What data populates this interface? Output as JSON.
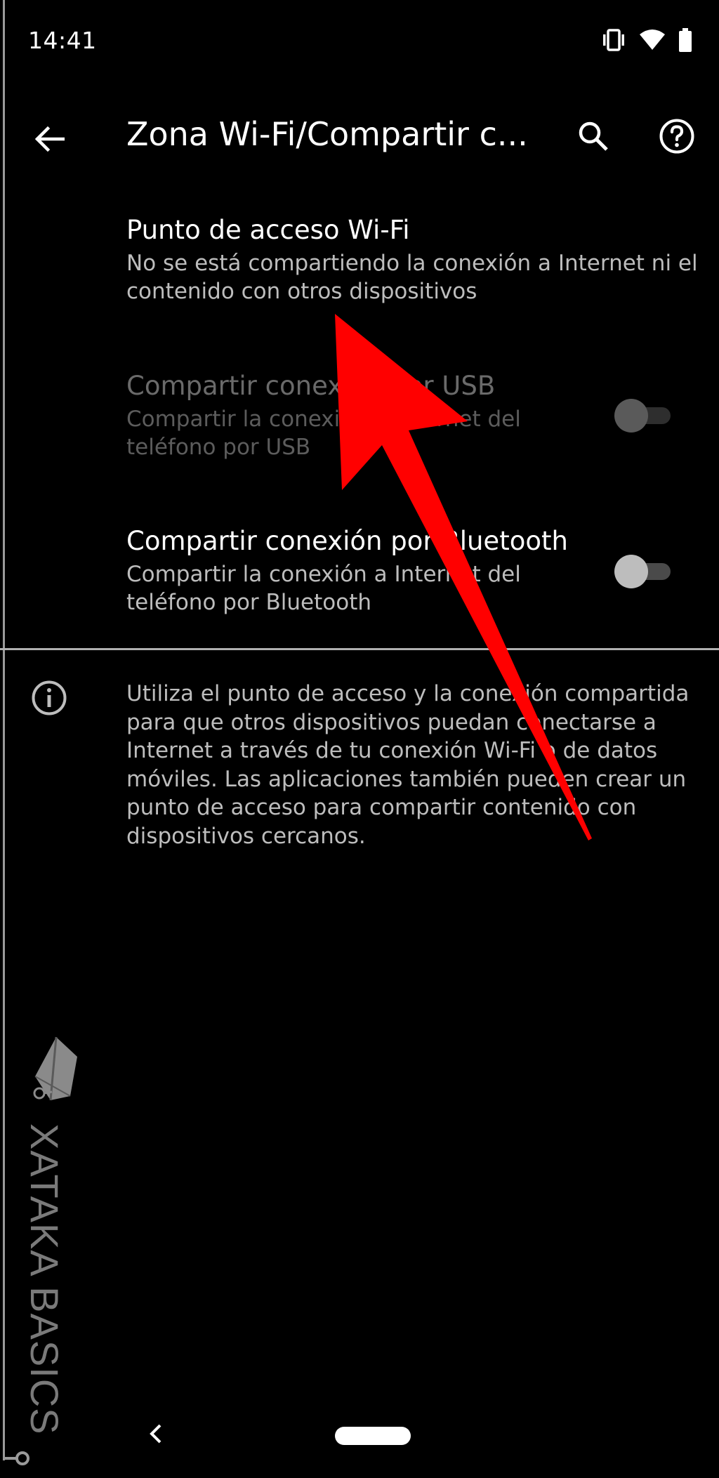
{
  "status_bar": {
    "time": "14:41",
    "icons": [
      "vibrate-icon",
      "wifi-icon",
      "battery-icon"
    ]
  },
  "app_bar": {
    "title": "Zona Wi-Fi/Compartir c...",
    "back_icon": "arrow-left-icon",
    "search_icon": "search-icon",
    "help_icon": "help-circle-icon"
  },
  "settings": [
    {
      "title": "Punto de acceso Wi-Fi",
      "summary": "No se está compartiendo la conexión a Internet ni el contenido con otros dispositivos",
      "enabled": true,
      "has_toggle": false
    },
    {
      "title": "Compartir conexión por USB",
      "summary": "Compartir la conexión a Internet del teléfono por USB",
      "enabled": false,
      "has_toggle": true,
      "toggle_on": false
    },
    {
      "title": "Compartir conexión por Bluetooth",
      "summary": "Compartir la conexión a Internet del teléfono por Bluetooth",
      "enabled": true,
      "has_toggle": true,
      "toggle_on": false
    }
  ],
  "info": {
    "icon": "info-icon",
    "text": "Utiliza el punto de acceso y la conexión compartida para que otros dispositivos puedan conectarse a Internet a través de tu conexión Wi-Fi o de datos móviles. Las aplicaciones también pueden crear un punto de acceso para compartir contenido con dispositivos cercanos."
  },
  "watermark": {
    "text": "XATAKA BASICS"
  },
  "annotation": {
    "arrow_color": "#ff0000"
  },
  "nav_bar": {
    "back_icon": "chevron-left-icon",
    "home_pill": "home-pill"
  },
  "colors": {
    "background": "#000000",
    "primary_text": "#ffffff",
    "secondary_text": "#bdbdbd",
    "disabled_text": "#6a6a6a"
  }
}
